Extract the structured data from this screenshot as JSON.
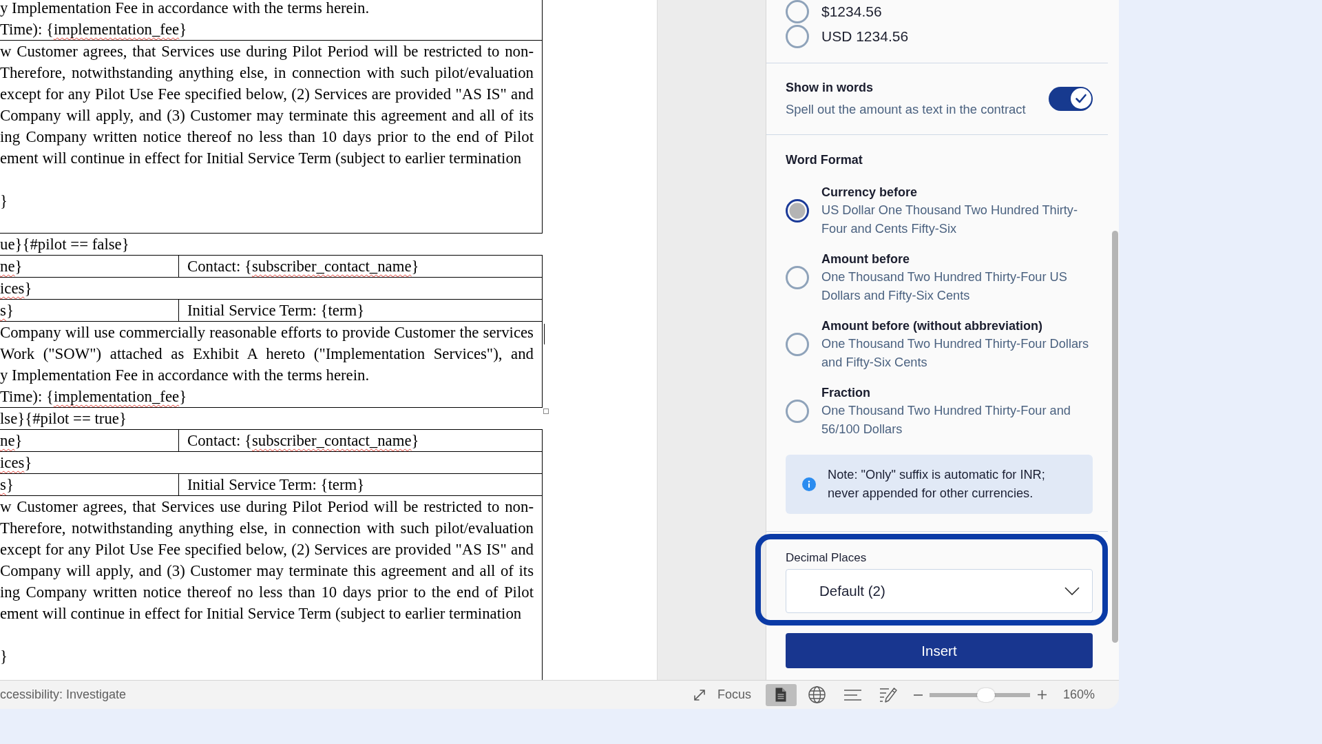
{
  "document": {
    "sections": [
      {
        "kind": "table",
        "active": false,
        "rows": [
          {
            "caret": false,
            "cells": [
              {
                "blocks": [
                  {
                    "kind": "line",
                    "text": "y Implementation Fee in accordance with the terms herein."
                  },
                  {
                    "kind": "line",
                    "text": [
                      {
                        "text": "Time): {",
                        "misspelled": false
                      },
                      {
                        "text": "implementation_fee",
                        "misspelled": true
                      },
                      {
                        "text": "}",
                        "misspelled": false
                      }
                    ]
                  }
                ]
              }
            ]
          },
          {
            "caret": false,
            "cells": [
              {
                "blocks": [
                  {
                    "kind": "para",
                    "lines": [
                      "w Customer agrees, that Services use during Pilot Period will be restricted to non-",
                      "Therefore, notwithstanding anything else, in connection with such pilot/evaluation",
                      "except for any Pilot Use Fee specified below, (2) Services are provided \"AS IS\" and",
                      "Company will apply, and (3) Customer may terminate this agreement and all of its",
                      "ing Company written notice thereof no less than 10 days prior to the end of Pilot",
                      "ement will continue in effect for Initial Service Term (subject to earlier termination"
                    ]
                  },
                  {
                    "kind": "gap"
                  },
                  {
                    "kind": "line",
                    "text": "}"
                  },
                  {
                    "kind": "gap"
                  }
                ]
              }
            ]
          }
        ]
      },
      {
        "kind": "line",
        "text": "ue}{#pilot == false}"
      },
      {
        "kind": "table",
        "active": true,
        "rows": [
          {
            "caret": false,
            "cells": [
              {
                "blocks": [
                  {
                    "kind": "line",
                    "text": [
                      {
                        "text": "ne",
                        "misspelled": true
                      },
                      {
                        "text": "}",
                        "misspelled": false
                      }
                    ]
                  }
                ]
              },
              {
                "blocks": [
                  {
                    "kind": "line",
                    "text": [
                      {
                        "text": "Contact: {",
                        "misspelled": false
                      },
                      {
                        "text": "subscriber_contact_name",
                        "misspelled": true
                      },
                      {
                        "text": "}",
                        "misspelled": false
                      }
                    ]
                  }
                ]
              }
            ]
          },
          {
            "caret": false,
            "cells": [
              {
                "blocks": [
                  {
                    "kind": "line",
                    "text": [
                      {
                        "text": "ices",
                        "misspelled": true
                      },
                      {
                        "text": "}",
                        "misspelled": false
                      }
                    ]
                  }
                ]
              }
            ]
          },
          {
            "caret": false,
            "cells": [
              {
                "blocks": [
                  {
                    "kind": "line",
                    "text": [
                      {
                        "text": "s",
                        "misspelled": true
                      },
                      {
                        "text": "}",
                        "misspelled": false
                      }
                    ]
                  }
                ]
              },
              {
                "blocks": [
                  {
                    "kind": "line",
                    "text": "Initial Service Term: {term}"
                  }
                ]
              }
            ]
          },
          {
            "caret": true,
            "cells": [
              {
                "blocks": [
                  {
                    "kind": "para",
                    "lines": [
                      "Company will use commercially reasonable efforts to provide Customer the services",
                      "Work (\"SOW\") attached as Exhibit A hereto (\"Implementation Services\"), and",
                      "y Implementation Fee in accordance with the terms herein."
                    ]
                  },
                  {
                    "kind": "line",
                    "text": [
                      {
                        "text": "Time): {",
                        "misspelled": false
                      },
                      {
                        "text": "implementation_fee",
                        "misspelled": true
                      },
                      {
                        "text": "}",
                        "misspelled": false
                      }
                    ]
                  }
                ]
              }
            ]
          }
        ]
      },
      {
        "kind": "line",
        "text": "lse}{#pilot == true}"
      },
      {
        "kind": "table",
        "active": false,
        "rows": [
          {
            "caret": false,
            "cells": [
              {
                "blocks": [
                  {
                    "kind": "line",
                    "text": [
                      {
                        "text": "ne",
                        "misspelled": true
                      },
                      {
                        "text": "}",
                        "misspelled": false
                      }
                    ]
                  }
                ]
              },
              {
                "blocks": [
                  {
                    "kind": "line",
                    "text": [
                      {
                        "text": "Contact: {",
                        "misspelled": false
                      },
                      {
                        "text": "subscriber_contact_name",
                        "misspelled": true
                      },
                      {
                        "text": "}",
                        "misspelled": false
                      }
                    ]
                  }
                ]
              }
            ]
          },
          {
            "caret": false,
            "cells": [
              {
                "blocks": [
                  {
                    "kind": "line",
                    "text": [
                      {
                        "text": "ices",
                        "misspelled": true
                      },
                      {
                        "text": "}",
                        "misspelled": false
                      }
                    ]
                  }
                ]
              }
            ]
          },
          {
            "caret": false,
            "cells": [
              {
                "blocks": [
                  {
                    "kind": "line",
                    "text": [
                      {
                        "text": "s",
                        "misspelled": true
                      },
                      {
                        "text": "}",
                        "misspelled": false
                      }
                    ]
                  }
                ]
              },
              {
                "blocks": [
                  {
                    "kind": "line",
                    "text": "Initial Service Term: {term}"
                  }
                ]
              }
            ]
          },
          {
            "caret": false,
            "cells": [
              {
                "blocks": [
                  {
                    "kind": "para",
                    "lines": [
                      "w Customer agrees, that Services use during Pilot Period will be restricted to non-",
                      "Therefore, notwithstanding anything else, in connection with such pilot/evaluation",
                      "except for any Pilot Use Fee specified below, (2) Services are provided \"AS IS\" and",
                      "Company will apply, and (3) Customer may terminate this agreement and all of its",
                      "ing Company written notice thereof no less than 10 days prior to the end of Pilot",
                      "ement will continue in effect for Initial Service Term (subject to earlier termination"
                    ]
                  },
                  {
                    "kind": "gap"
                  },
                  {
                    "kind": "line",
                    "text": "}"
                  },
                  {
                    "kind": "gap"
                  }
                ]
              }
            ]
          }
        ]
      }
    ]
  },
  "panel": {
    "currency_options": [
      {
        "label": "$1234.56",
        "selected": false
      },
      {
        "label": "USD 1234.56",
        "selected": false
      }
    ],
    "show_in_words": {
      "title": "Show in words",
      "description": "Spell out the amount as text in the contract",
      "on": true
    },
    "word_format": {
      "heading": "Word Format",
      "options": [
        {
          "title": "Currency before",
          "example": "US Dollar One Thousand Two Hundred Thirty-Four and Cents Fifty-Six",
          "selected": true
        },
        {
          "title": "Amount before",
          "example": "One Thousand Two Hundred Thirty-Four US Dollars and Fifty-Six Cents",
          "selected": false
        },
        {
          "title": "Amount before (without abbreviation)",
          "example": "One Thousand Two Hundred Thirty-Four Dollars and Fifty-Six Cents",
          "selected": false
        },
        {
          "title": "Fraction",
          "example": "One Thousand Two Hundred Thirty-Four and 56/100 Dollars",
          "selected": false
        }
      ]
    },
    "note": "Note: \"Only\" suffix is automatic for INR; never appended for other currencies.",
    "decimal_places": {
      "label": "Decimal Places",
      "value": "Default (2)",
      "highlighted": true
    },
    "insert_button": "Insert"
  },
  "status_bar": {
    "accessibility": "ccessibility: Investigate",
    "focus": "Focus",
    "views": [
      {
        "kind": "print",
        "selected": true
      },
      {
        "kind": "web",
        "selected": false
      },
      {
        "kind": "outline",
        "selected": false
      },
      {
        "kind": "draft",
        "selected": false
      }
    ],
    "zoom": {
      "level": 0.56,
      "reading": "160%"
    }
  }
}
